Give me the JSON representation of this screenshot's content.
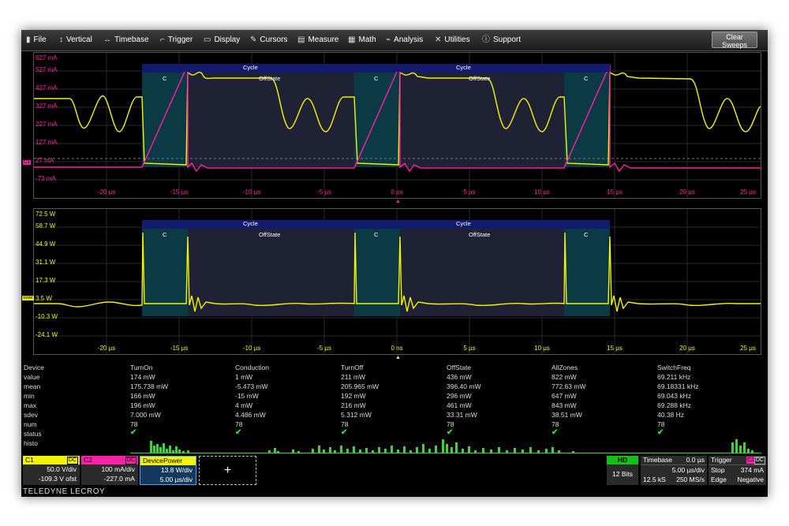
{
  "menu": {
    "file": "File",
    "vertical": "Vertical",
    "timebase": "Timebase",
    "trigger": "Trigger",
    "display": "Display",
    "cursors": "Cursors",
    "measure": "Measure",
    "math": "Math",
    "analysis": "Analysis",
    "utilities": "Utilities",
    "support": "Support",
    "clear_sweeps": "Clear Sweeps"
  },
  "grid1": {
    "y_labels": [
      "627 mA",
      "527 mA",
      "427 mA",
      "327 mA",
      "227 mA",
      "127 mA",
      "27 mA",
      "-73 mA"
    ],
    "x_labels": [
      "-20 µs",
      "-15 µs",
      "-10 µs",
      "-5 µs",
      "0 µs",
      "5 µs",
      "10 µs",
      "15 µs",
      "20 µs",
      "25 µs"
    ],
    "marker": "C2"
  },
  "grid2": {
    "y_labels": [
      "72.5 W",
      "58.7 W",
      "44.9 W",
      "31.1 W",
      "17.3 W",
      "3.5 W",
      "-10.3 W",
      "-24.1 W"
    ],
    "x_labels": [
      "-20 µs",
      "-15 µs",
      "-10 µs",
      "-5 µs",
      "0 ns",
      "5 µs",
      "10 µs",
      "15 µs",
      "20 µs",
      "25 µs"
    ],
    "marker": "ower"
  },
  "zones": {
    "cycle": "Cycle",
    "offstate": "OffState",
    "c": "C"
  },
  "chart_data": {
    "type": "table",
    "columns": [
      "Device",
      "TurnOn",
      "Conduction",
      "TurnOff",
      "OffState",
      "AllZones",
      "SwitchFreq"
    ],
    "rows": [
      [
        "value",
        "174 mW",
        "1 mW",
        "211 mW",
        "436 mW",
        "822 mW",
        "69.211 kHz"
      ],
      [
        "mean",
        "175.738 mW",
        "-5.473 mW",
        "205.965 mW",
        "396.40 mW",
        "772.63 mW",
        "69.18331 kHz"
      ],
      [
        "min",
        "166 mW",
        "-15 mW",
        "192 mW",
        "296 mW",
        "647 mW",
        "69.043 kHz"
      ],
      [
        "max",
        "196 mW",
        "4 mW",
        "216 mW",
        "461 mW",
        "843 mW",
        "69.288 kHz"
      ],
      [
        "sdev",
        "7.000 mW",
        "4.486 mW",
        "5.312 mW",
        "33.31 mW",
        "38.51 mW",
        "40.38 Hz"
      ],
      [
        "num",
        "78",
        "78",
        "78",
        "78",
        "78",
        "78"
      ],
      [
        "status",
        "",
        "",
        "",
        "",
        "",
        ""
      ],
      [
        "histo",
        "",
        "",
        "",
        "",
        "",
        ""
      ]
    ]
  },
  "channels": {
    "c1": {
      "name": "C1",
      "tag": "DC",
      "vdiv": "50.0 V/div",
      "offset": "-109.3 V ofst",
      "color": "#f4f400"
    },
    "c2": {
      "name": "C2",
      "tag": "DC",
      "vdiv": "100 mA/div",
      "offset": "-227.0 mA",
      "color": "#ff1fa8"
    },
    "dp": {
      "name": "DevicePower",
      "vdiv": "13.8 W/div",
      "tdiv": "5.00 µs/div",
      "color": "#f4f400"
    },
    "add": "+"
  },
  "acq": {
    "hd": "HD",
    "bits": "12 Bits"
  },
  "timebase": {
    "label": "Timebase",
    "delay": "0.0 µs",
    "tdiv": "5.00 µs/div",
    "samples": "12.5 kS",
    "rate": "250 MS/s"
  },
  "trigger": {
    "label": "Trigger",
    "src": "C2",
    "cpl": "DC",
    "mode": "Stop",
    "level": "374 mA",
    "type": "Edge",
    "slope": "Negative"
  },
  "brand": "TELEDYNE LECROY"
}
